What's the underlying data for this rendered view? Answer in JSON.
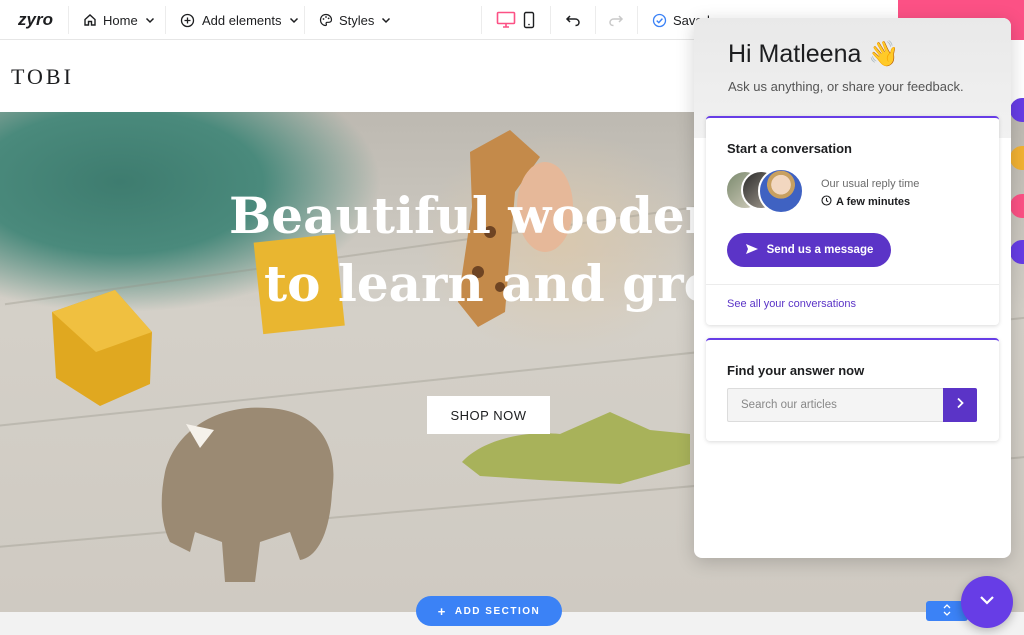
{
  "toolbar": {
    "logo": "zyro",
    "page_menu": "Home",
    "add_elements": "Add elements",
    "styles": "Styles",
    "saved": "Saved"
  },
  "site": {
    "logo": "TOBI",
    "hero_title_line1": "Beautiful wooden to",
    "hero_title_line2": "to learn and grow",
    "shop_now": "SHOP NOW",
    "add_section": "ADD SECTION"
  },
  "widget": {
    "greeting": "Hi Matleena 👋",
    "subtitle": "Ask us anything, or share your feedback.",
    "conversation": {
      "title": "Start a conversation",
      "reply_label": "Our usual reply time",
      "reply_value": "A few minutes",
      "send_button": "Send us a message",
      "see_all": "See all your conversations"
    },
    "answers": {
      "title": "Find your answer now",
      "search_placeholder": "Search our articles"
    }
  },
  "colors": {
    "accent": "#673de6",
    "button_purple": "#5b34c7",
    "add_section_blue": "#3b82f6",
    "brand_pink": "#fc5185",
    "desktop_icon_active": "#fc5185"
  },
  "icons": [
    "home-icon",
    "plus-circle-icon",
    "palette-icon",
    "chevron-down-icon",
    "desktop-icon",
    "mobile-icon",
    "undo-icon",
    "redo-icon",
    "check-circle-icon",
    "clock-icon",
    "send-icon",
    "chevron-right-icon",
    "chevron-down-icon",
    "plus-icon",
    "arrows-up-down-icon"
  ]
}
